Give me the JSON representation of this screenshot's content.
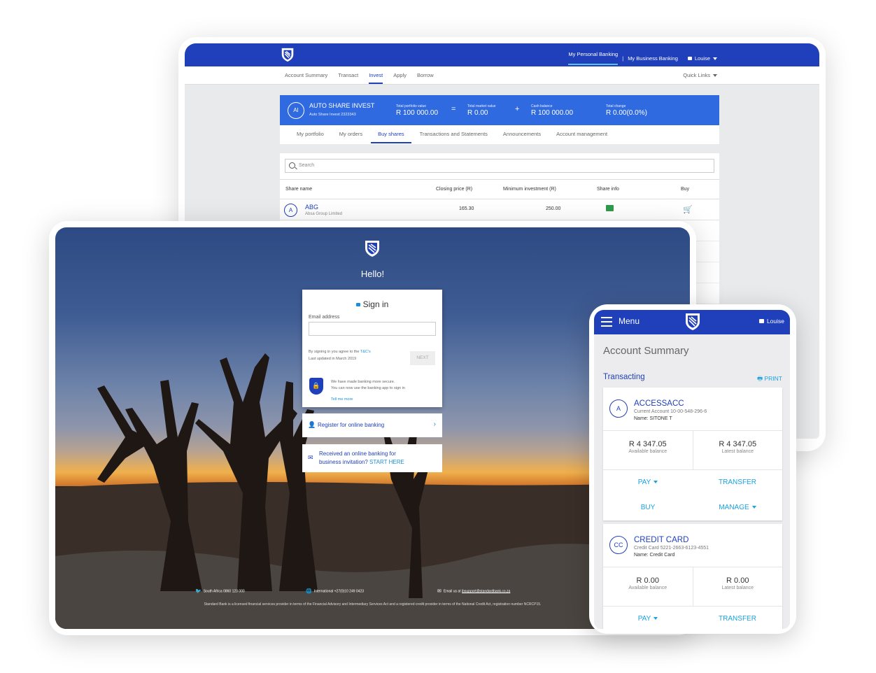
{
  "desktop": {
    "topnav": {
      "personal": "My Personal Banking",
      "separator": "|",
      "business": "My Business Banking",
      "user": "Louise"
    },
    "menu": {
      "items": [
        "Account Summary",
        "Transact",
        "Invest",
        "Apply",
        "Borrow"
      ],
      "active": "Invest",
      "quick_links": "Quick Links"
    },
    "account": {
      "initials": "AI",
      "name": "AUTO SHARE INVEST",
      "sub": "Auto Share Invest 2323343",
      "portfolio_label": "Total portfolio value",
      "portfolio_value": "R 100 000.00",
      "op_equals": "=",
      "market_label": "Total market value",
      "market_value": "R 0.00",
      "op_plus": "+",
      "cash_label": "Cash balance",
      "cash_value": "R 100 000.00",
      "change_label": "Total change",
      "change_value": "R 0.00(0.0%)"
    },
    "tabs": [
      "My portfolio",
      "My orders",
      "Buy shares",
      "Transactions and Statements",
      "Announcements",
      "Account management"
    ],
    "search_placeholder": "Search",
    "table": {
      "headers": [
        "Share name",
        "Closing price (R)",
        "Minimum investment (R)",
        "Share info",
        "Buy"
      ],
      "rows": [
        {
          "initial": "A",
          "code": "ABG",
          "name": "Absa Group Limited",
          "closing": "165.30",
          "min": "250.00"
        }
      ]
    }
  },
  "login": {
    "hello": "Hello!",
    "signin_title": "Sign in",
    "email_label": "Email address",
    "terms_line1": "By signing in you agree to the ",
    "terms_link": "T&C's",
    "terms_line2": "Last updated in March 2019",
    "next": "NEXT",
    "secure_line1": "We have made banking more secure.",
    "secure_line2": "You can now use the banking app to sign in",
    "tell_more": "Tell me more",
    "register": "Register for online banking",
    "invite_line1": "Received an online banking for",
    "invite_line2": "business invitation? ",
    "invite_start": "START HERE",
    "footer_sa": "South Africa 0860 123 000",
    "footer_intl": "International +27(0)10 249 0423",
    "footer_email_pre": "Email us at ",
    "footer_email": "ibsupport@standardbank.co.za",
    "legal": "Standard Bank is a licensed financial services provider in terms of the Financial Advisory and Intermediary Services Act and a registered credit provider in terms of the National Credit Act, registration number NCRCP15."
  },
  "phone": {
    "menu": "Menu",
    "user": "Louise",
    "title": "Account Summary",
    "section": "Transacting",
    "print": "PRINT",
    "cards": [
      {
        "initials": "A",
        "name": "ACCESSACC",
        "account": "Current Account 10-00-548-296-6",
        "owner": "Name: SITONE T",
        "available": "R 4 347.05",
        "available_label": "Available balance",
        "latest": "R 4 347.05",
        "latest_label": "Latest balance",
        "actions": [
          "PAY",
          "TRANSFER",
          "BUY",
          "MANAGE"
        ]
      },
      {
        "initials": "CC",
        "name": "CREDIT CARD",
        "account": "Credit Card 5221-2663-6123-4551",
        "owner": "Name: Credit Card",
        "available": "R 0.00",
        "available_label": "Available balance",
        "latest": "R 0.00",
        "latest_label": "Latest balance",
        "actions": [
          "PAY",
          "TRANSFER"
        ]
      }
    ]
  },
  "colors": {
    "brand_blue": "#1f3fbb",
    "accent_blue": "#1aa1e0",
    "card_blue": "#2f6ae0"
  }
}
